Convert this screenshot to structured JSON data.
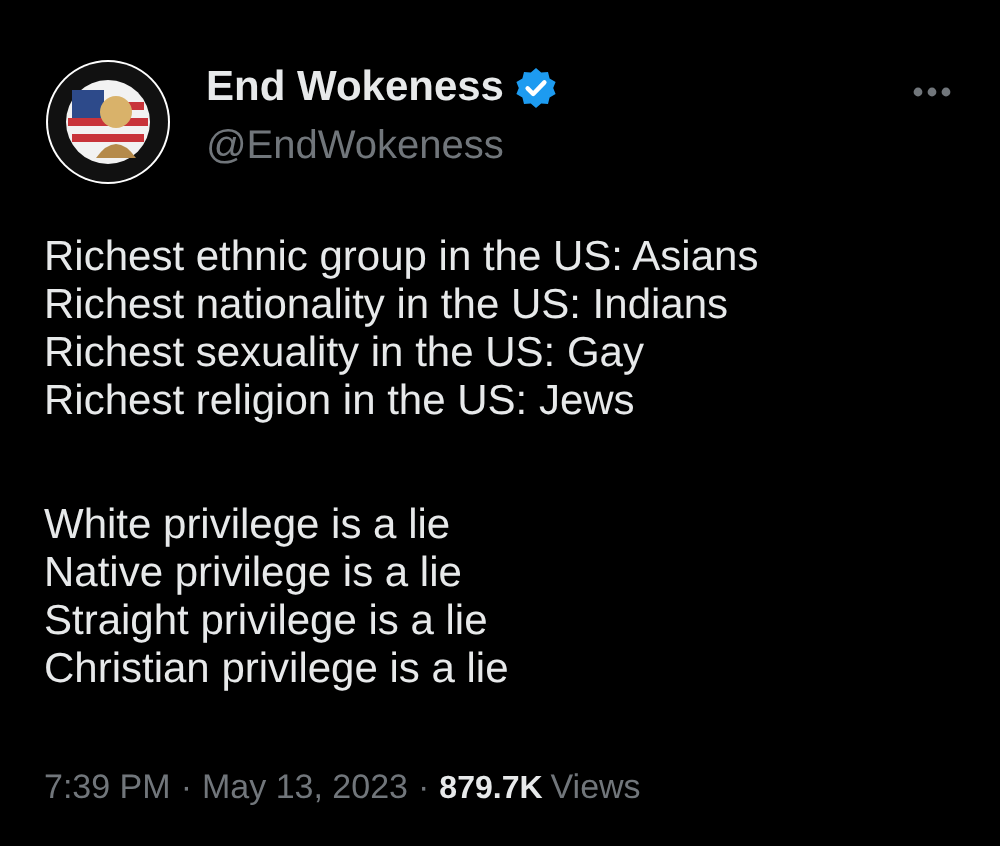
{
  "author": {
    "name": "End Wokeness",
    "verified": true,
    "handle": "@EndWokeness"
  },
  "paragraphs": [
    [
      "Richest ethnic group in the US: Asians",
      "Richest nationality in the US: Indians",
      "Richest sexuality in the US: Gay",
      "Richest religion in the US: Jews"
    ],
    [
      "White privilege is a lie",
      "Native privilege is a lie",
      "Straight privilege is a lie",
      "Christian privilege is a lie"
    ]
  ],
  "meta": {
    "time": "7:39 PM",
    "separator_1": "·",
    "date": "May 13, 2023",
    "separator_2": "·",
    "views_count": "879.7K",
    "views_label": "Views"
  }
}
